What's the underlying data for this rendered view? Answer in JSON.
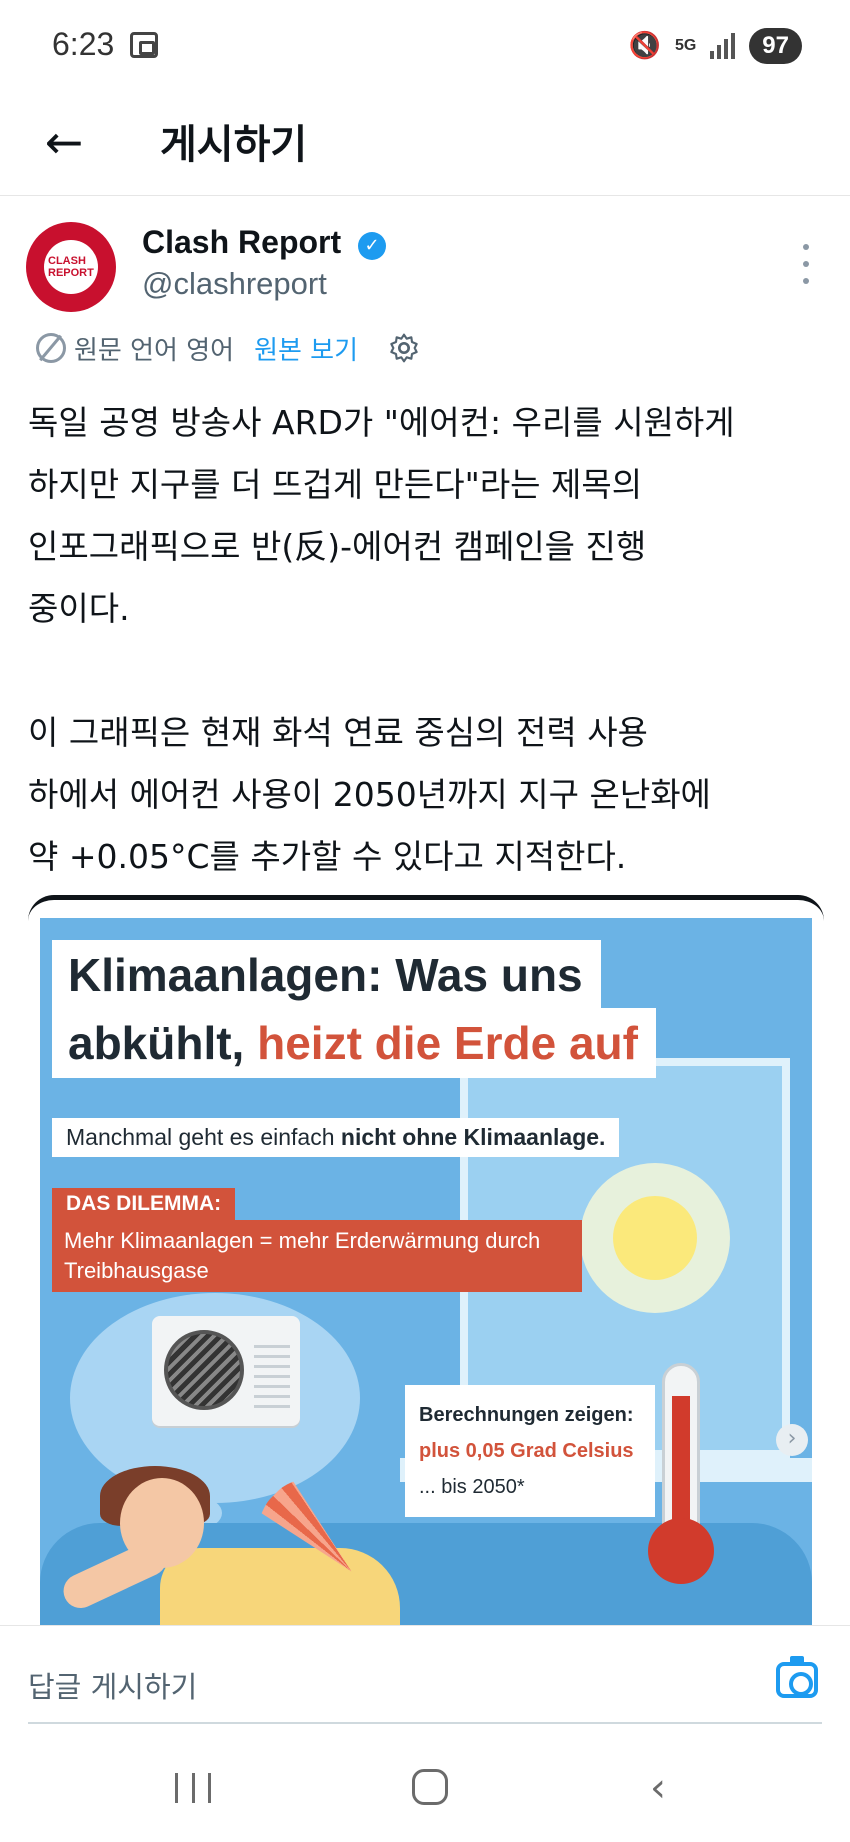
{
  "status_bar": {
    "time": "6:23",
    "network": "5G",
    "battery": "97"
  },
  "header": {
    "title": "게시하기"
  },
  "author": {
    "name": "Clash Report",
    "handle": "@clashreport",
    "avatar_text": "CLASH REPORT"
  },
  "translation": {
    "source_label": "원문 언어 영어",
    "show_original": "원본 보기"
  },
  "post": {
    "text": "독일 공영 방송사 ARD가 \"에어컨: 우리를 시원하게\n하지만 지구를 더 뜨겁게 만든다\"라는 제목의\n인포그래픽으로 반(反)-에어컨 캠페인을 진행\n중이다.\n\n이 그래픽은 현재 화석 연료 중심의 전력 사용\n하에서 에어컨 사용이 2050년까지 지구 온난화에\n약 +0.05°C를 추가할 수 있다고 지적한다."
  },
  "infographic": {
    "title_line1": "Klimaanlagen: Was uns",
    "title_line2_dark": "abkühlt, ",
    "title_line2_red": "heizt die Erde auf",
    "subtitle_plain": "Manchmal geht es einfach ",
    "subtitle_bold": "nicht ohne Klimaanlage.",
    "dilemma_label": "DAS DILEMMA:",
    "dilemma_text": "Mehr Klimaanlagen = mehr Erderwärmung durch Treibhausgase",
    "calc_title": "Berechnungen zeigen:",
    "calc_value": "plus 0,05 Grad Celsius",
    "calc_note": "... bis 2050*"
  },
  "reply": {
    "placeholder": "답글 게시하기"
  },
  "colors": {
    "accent": "#1d9bf0",
    "brand_red": "#c8102e",
    "infographic_red": "#d2533b",
    "infographic_blue": "#6bb3e5"
  },
  "icons": [
    "back-arrow-icon",
    "verified-icon",
    "more-icon",
    "translate-icon",
    "gear-icon",
    "camera-icon",
    "next-arrow-icon"
  ]
}
